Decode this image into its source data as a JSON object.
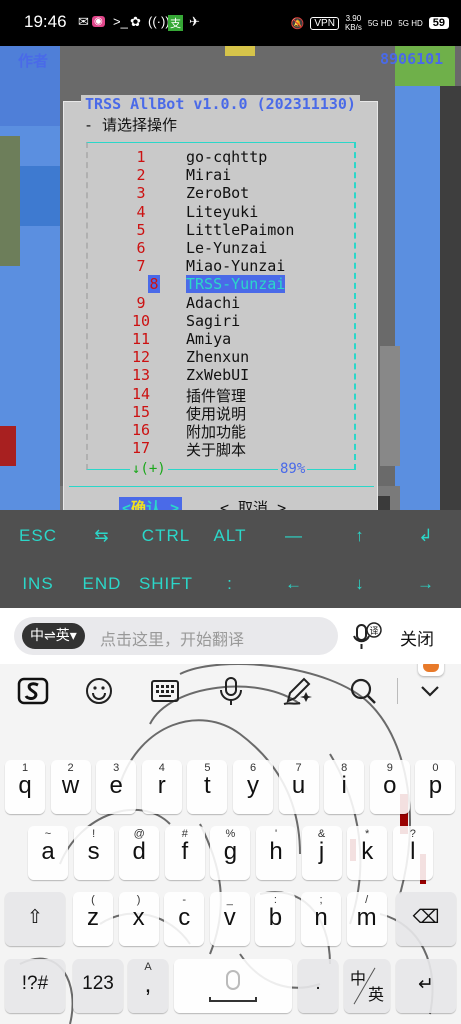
{
  "status_bar": {
    "time": "19:46",
    "vpn": "VPN",
    "speed": "3.90",
    "speed_unit": "KB/s",
    "net1": "5G HD",
    "net2": "5G HD",
    "battery": "59"
  },
  "terminal": {
    "header_left": "作者",
    "header_right": "8906101",
    "dialog_title": "TRSS AllBot v1.0.0 (202311130)",
    "prompt": "- 请选择操作",
    "menu": [
      {
        "num": "1",
        "label": "go-cqhttp"
      },
      {
        "num": "2",
        "label": "Mirai"
      },
      {
        "num": "3",
        "label": "ZeroBot"
      },
      {
        "num": "4",
        "label": "Liteyuki"
      },
      {
        "num": "5",
        "label": "LittlePaimon"
      },
      {
        "num": "6",
        "label": "Le-Yunzai"
      },
      {
        "num": "7",
        "label": "Miao-Yunzai"
      },
      {
        "num": "8",
        "label": "TRSS-Yunzai"
      },
      {
        "num": "9",
        "label": "Adachi"
      },
      {
        "num": "10",
        "label": "Sagiri"
      },
      {
        "num": "11",
        "label": "Amiya"
      },
      {
        "num": "12",
        "label": "Zhenxun"
      },
      {
        "num": "13",
        "label": "ZxWebUI"
      },
      {
        "num": "14",
        "label": "插件管理"
      },
      {
        "num": "15",
        "label": "使用说明"
      },
      {
        "num": "16",
        "label": "附加功能"
      },
      {
        "num": "17",
        "label": "关于脚本"
      }
    ],
    "selected_index": 7,
    "scroll_indicator": "↓(+)",
    "scroll_percent": "89%",
    "ok_left": "<",
    "ok_hot": "确",
    "ok_rest": "认",
    "ok_right": ">",
    "cancel": "< 取消 >"
  },
  "extra_keys": {
    "row1": [
      "ESC",
      "⇆",
      "CTRL",
      "ALT",
      "—",
      "↑",
      "↲"
    ],
    "row2": [
      "INS",
      "END",
      "SHIFT",
      ":",
      "←",
      "↓",
      "→"
    ]
  },
  "translate_bar": {
    "lang": "中⇌英▾",
    "placeholder": "点击这里，开始翻译",
    "mic_badge": "译",
    "close": "关闭"
  },
  "keyboard": {
    "toolbar_icons": [
      "sogou-logo-icon",
      "emoji-icon",
      "keyboard-icon",
      "voice-icon",
      "handwriting-icon",
      "search-icon",
      "collapse-icon"
    ],
    "row1": [
      {
        "sub": "1",
        "key": "q"
      },
      {
        "sub": "2",
        "key": "w"
      },
      {
        "sub": "3",
        "key": "e"
      },
      {
        "sub": "4",
        "key": "r"
      },
      {
        "sub": "5",
        "key": "t"
      },
      {
        "sub": "6",
        "key": "y"
      },
      {
        "sub": "7",
        "key": "u"
      },
      {
        "sub": "8",
        "key": "i"
      },
      {
        "sub": "9",
        "key": "o"
      },
      {
        "sub": "0",
        "key": "p"
      }
    ],
    "row2": [
      {
        "sub": "~",
        "key": "a"
      },
      {
        "sub": "!",
        "key": "s"
      },
      {
        "sub": "@",
        "key": "d"
      },
      {
        "sub": "#",
        "key": "f"
      },
      {
        "sub": "%",
        "key": "g"
      },
      {
        "sub": "'",
        "key": "h"
      },
      {
        "sub": "&",
        "key": "j"
      },
      {
        "sub": "*",
        "key": "k"
      },
      {
        "sub": "?",
        "key": "l"
      }
    ],
    "row3": [
      {
        "sub": "(",
        "key": "z"
      },
      {
        "sub": ")",
        "key": "x"
      },
      {
        "sub": "-",
        "key": "c"
      },
      {
        "sub": "_",
        "key": "v"
      },
      {
        "sub": ":",
        "key": "b"
      },
      {
        "sub": ";",
        "key": "n"
      },
      {
        "sub": "/",
        "key": "m"
      }
    ],
    "shift": "⇧",
    "backspace": "⌫",
    "symbols": "!?#",
    "num": "123",
    "comma": ",",
    "comma_sub": "A",
    "space_icon": "space-mic-icon",
    "period": ".",
    "lang_top": "中",
    "lang_bottom": "英",
    "enter": "↵"
  }
}
